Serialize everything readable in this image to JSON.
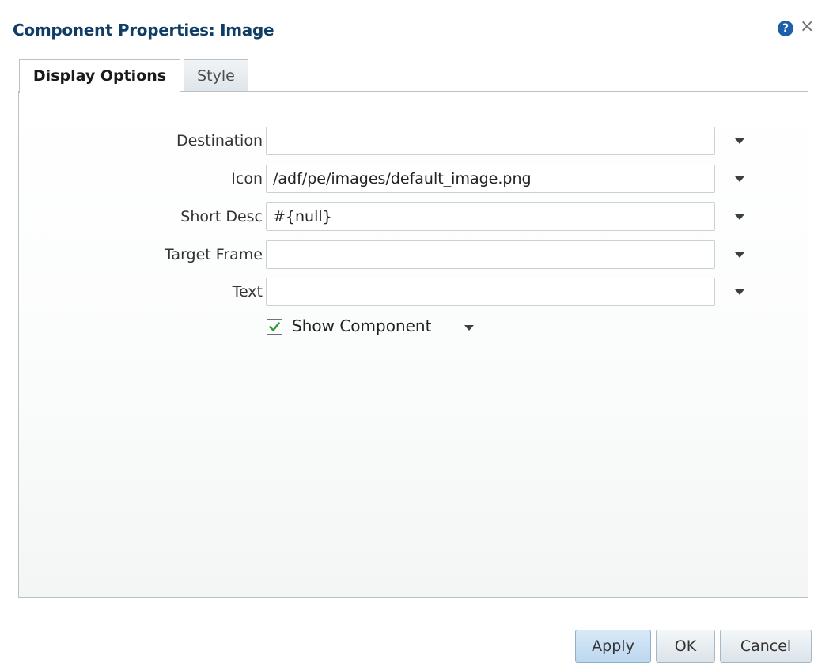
{
  "dialog": {
    "title": "Component Properties: Image",
    "help_icon": "help-icon",
    "close_icon": "close-icon"
  },
  "tabs": [
    {
      "label": "Display Options",
      "selected": true
    },
    {
      "label": "Style",
      "selected": false
    }
  ],
  "fields": [
    {
      "label": "Destination",
      "value": ""
    },
    {
      "label": "Icon",
      "value": "/adf/pe/images/default_image.png"
    },
    {
      "label": "Short Desc",
      "value": "#{null}"
    },
    {
      "label": "Target Frame",
      "value": ""
    },
    {
      "label": "Text",
      "value": ""
    }
  ],
  "show_component": {
    "label": "Show Component",
    "checked": true
  },
  "buttons": {
    "apply": "Apply",
    "ok": "OK",
    "cancel": "Cancel"
  },
  "colors": {
    "title": "#0f3d66",
    "help_icon": "#1d5fa8",
    "checkmark": "#2e9e3c",
    "apply_button": "#bcd7ef"
  }
}
